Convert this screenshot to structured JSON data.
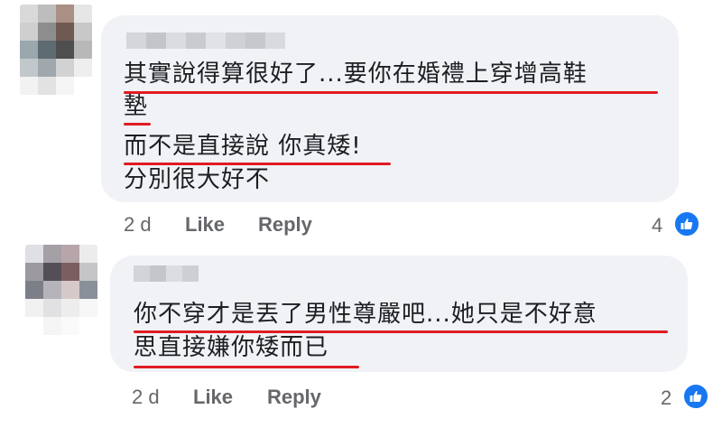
{
  "comments": [
    {
      "lines": [
        "其實說得算很好了...要你在婚禮上穿增高鞋",
        "墊",
        "而不是直接說 你真矮!",
        "分別很大好不"
      ],
      "time": "2 d",
      "like_label": "Like",
      "reply_label": "Reply",
      "reaction_count": "4"
    },
    {
      "lines": [
        "你不穿才是丟了男性尊嚴吧...她只是不好意",
        "思直接嫌你矮而已"
      ],
      "time": "2 d",
      "like_label": "Like",
      "reply_label": "Reply",
      "reaction_count": "2"
    }
  ],
  "colors": {
    "bubble": "#f0f2f5",
    "underline": "#e11b22",
    "like_badge": "#1877f2",
    "meta_text": "#65676b"
  },
  "icons": [
    "blurred-avatar",
    "like-thumb-icon"
  ]
}
